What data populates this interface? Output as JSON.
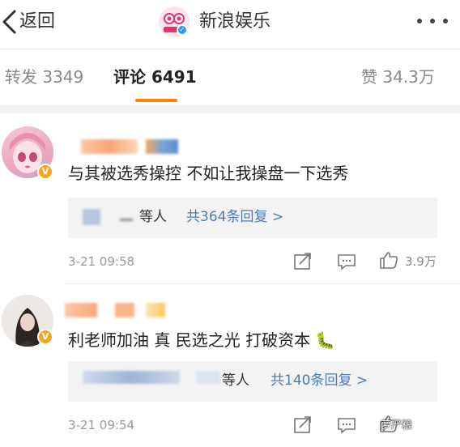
{
  "header": {
    "back_label": "返回",
    "title": "新浪娱乐"
  },
  "tabs": [
    {
      "label": "转发 3349"
    },
    {
      "label": "评论 6491"
    },
    {
      "label": "赞 34.3万"
    }
  ],
  "comments": [
    {
      "text": "与其被选秀操控 不如让我操盘一下选秀",
      "reply_prefix": "等人",
      "reply_link": "共364条回复 >",
      "time": "3-21 09:58",
      "likes": "3.9万"
    },
    {
      "text": "利老师加油 真 民选之光 打破资本 🐛",
      "reply_prefix": "等人",
      "reply_link": "共140条回复 >",
      "time": "3-21 09:54",
      "likes": ""
    }
  ],
  "watermark": "萝严粮",
  "colors": {
    "accent": "#ff8200",
    "link": "#4f7bb8",
    "badge": "#f5a623"
  },
  "icons": [
    "back-icon",
    "sina-logo",
    "more-icon",
    "verified-badge",
    "share-icon",
    "comment-icon",
    "like-icon"
  ]
}
